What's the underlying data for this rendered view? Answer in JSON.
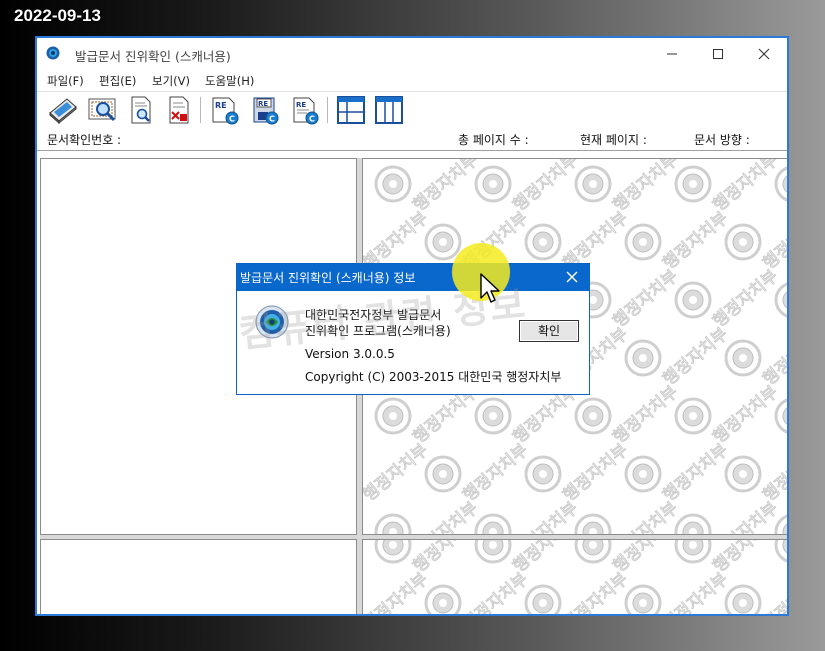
{
  "date_stamp": "2022-09-13",
  "window": {
    "title": "발급문서 진위확인 (스캐너용)",
    "controls": {
      "minimize": "—",
      "maximize": "☐",
      "close": "✕"
    }
  },
  "menu": [
    {
      "label": "파일(F)"
    },
    {
      "label": "편집(E)"
    },
    {
      "label": "보기(V)"
    },
    {
      "label": "도움말(H)"
    }
  ],
  "toolbar": {
    "buttons": [
      {
        "icon": "scanner-icon"
      },
      {
        "icon": "certificate-search-icon"
      },
      {
        "icon": "document-search-icon"
      },
      {
        "icon": "document-delete-icon"
      },
      {
        "icon": "re-document-c-icon"
      },
      {
        "icon": "re-save-c-icon"
      },
      {
        "icon": "re-page-c-icon"
      },
      {
        "icon": "layout-horizontal-icon"
      },
      {
        "icon": "layout-vertical-icon"
      }
    ],
    "re_text": "RE",
    "c_text": "C"
  },
  "info_bar": {
    "doc_number_label": "문서확인번호 :",
    "total_pages_label": "총 페이지 수 :",
    "current_page_label": "현재 페이지 :",
    "doc_direction_label": "문서 방향 :"
  },
  "watermark_text": "행정자치부",
  "site_watermark": "컴퓨터 관련 정보",
  "dialog": {
    "title": "발급문서 진위확인 (스캐너용) 정보",
    "close": "✕",
    "line1": "대한민국전자정부 발급문서",
    "line2": "진위확인 프로그램(스캐너용)",
    "version": "Version 3.0.0.5",
    "copyright": "Copyright (C)  2003-2015  대한민국 행정자치부",
    "ok_label": "확인"
  },
  "colors": {
    "window_border": "#2b79d8",
    "dialog_title_bg": "#0a67cc",
    "cursor_highlight": "#f5eb1e"
  }
}
